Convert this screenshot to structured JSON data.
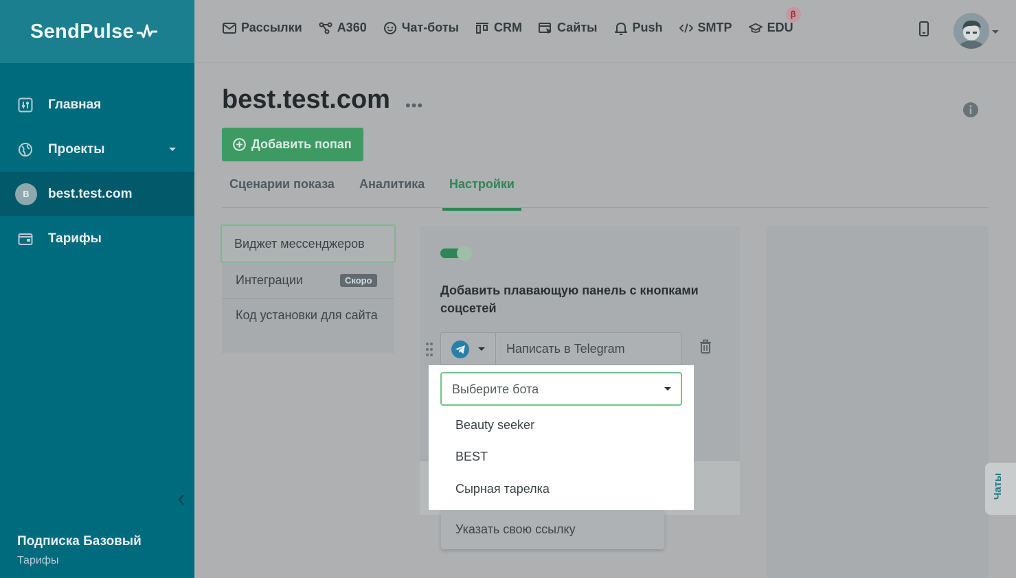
{
  "brand": {
    "name": "SendPulse"
  },
  "sidebar": {
    "items": [
      {
        "label": "Главная",
        "icon": "dashboard-icon"
      },
      {
        "label": "Проекты",
        "icon": "globe-icon"
      },
      {
        "label": "best.test.com",
        "avatar_letter": "B"
      },
      {
        "label": "Тарифы",
        "icon": "wallet-icon"
      }
    ],
    "subscription": {
      "title": "Подписка Базовый",
      "link": "Тарифы"
    }
  },
  "topnav": {
    "items": [
      {
        "label": "Рассылки",
        "icon": "mail-icon"
      },
      {
        "label": "A360",
        "icon": "automation-icon"
      },
      {
        "label": "Чат-боты",
        "icon": "chatbot-icon"
      },
      {
        "label": "CRM",
        "icon": "kanban-icon"
      },
      {
        "label": "Сайты",
        "icon": "site-icon"
      },
      {
        "label": "Push",
        "icon": "bell-icon"
      },
      {
        "label": "SMTP",
        "icon": "code-icon"
      },
      {
        "label": "EDU",
        "icon": "graduation-icon",
        "badge": "β"
      }
    ]
  },
  "page": {
    "title": "best.test.com",
    "more": "•••",
    "add_button": "Добавить попап",
    "tabs": [
      "Сценарии показа",
      "Аналитика",
      "Настройки"
    ],
    "active_tab": "Настройки"
  },
  "settings_menu": {
    "items": [
      "Виджет мессенджеров",
      "Интеграции",
      "Код установки для сайта"
    ],
    "soon_badge": "Скоро"
  },
  "widget": {
    "enabled": true,
    "title": "Добавить плавающую панель с кнопками соцсетей",
    "messenger_button_text": "Написать в Telegram",
    "bot_select_placeholder": "Выберите бота",
    "bot_options": [
      "Beauty seeker",
      "BEST",
      "Сырная тарелка"
    ],
    "custom_link_option": "Указать свою ссылку"
  },
  "chats_tab": "Чаты",
  "colors": {
    "sidebar": "#006b7d",
    "accent_green": "#2e8555",
    "telegram": "#2aa3d8"
  }
}
